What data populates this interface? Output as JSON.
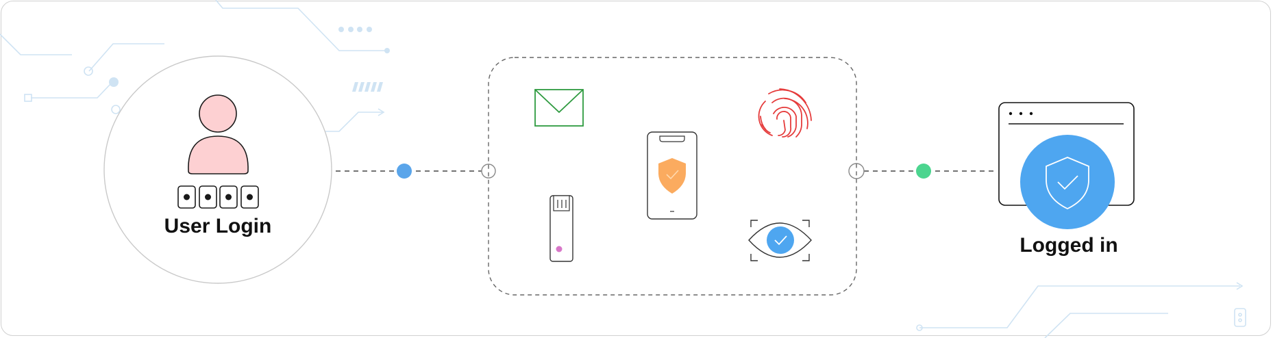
{
  "login": {
    "title": "User Login",
    "pin_dots": 4
  },
  "result": {
    "title": "Logged in"
  },
  "colors": {
    "user_fill": "#fdd0d2",
    "node_blue": "#5aa5ea",
    "node_green": "#4cd58f",
    "shield_orange": "#fbab5f",
    "envelope_green": "#2e9a3f",
    "fingerprint_red": "#e53b3b",
    "eye_blue": "#4ea6f0",
    "usb_led": "#d877c8",
    "circuit": "#cfe3f3"
  },
  "icons": [
    "user-avatar-icon",
    "envelope-icon",
    "fingerprint-icon",
    "smartphone-shield-icon",
    "usb-security-key-icon",
    "eye-scan-icon",
    "browser-window-icon",
    "shield-check-icon"
  ]
}
